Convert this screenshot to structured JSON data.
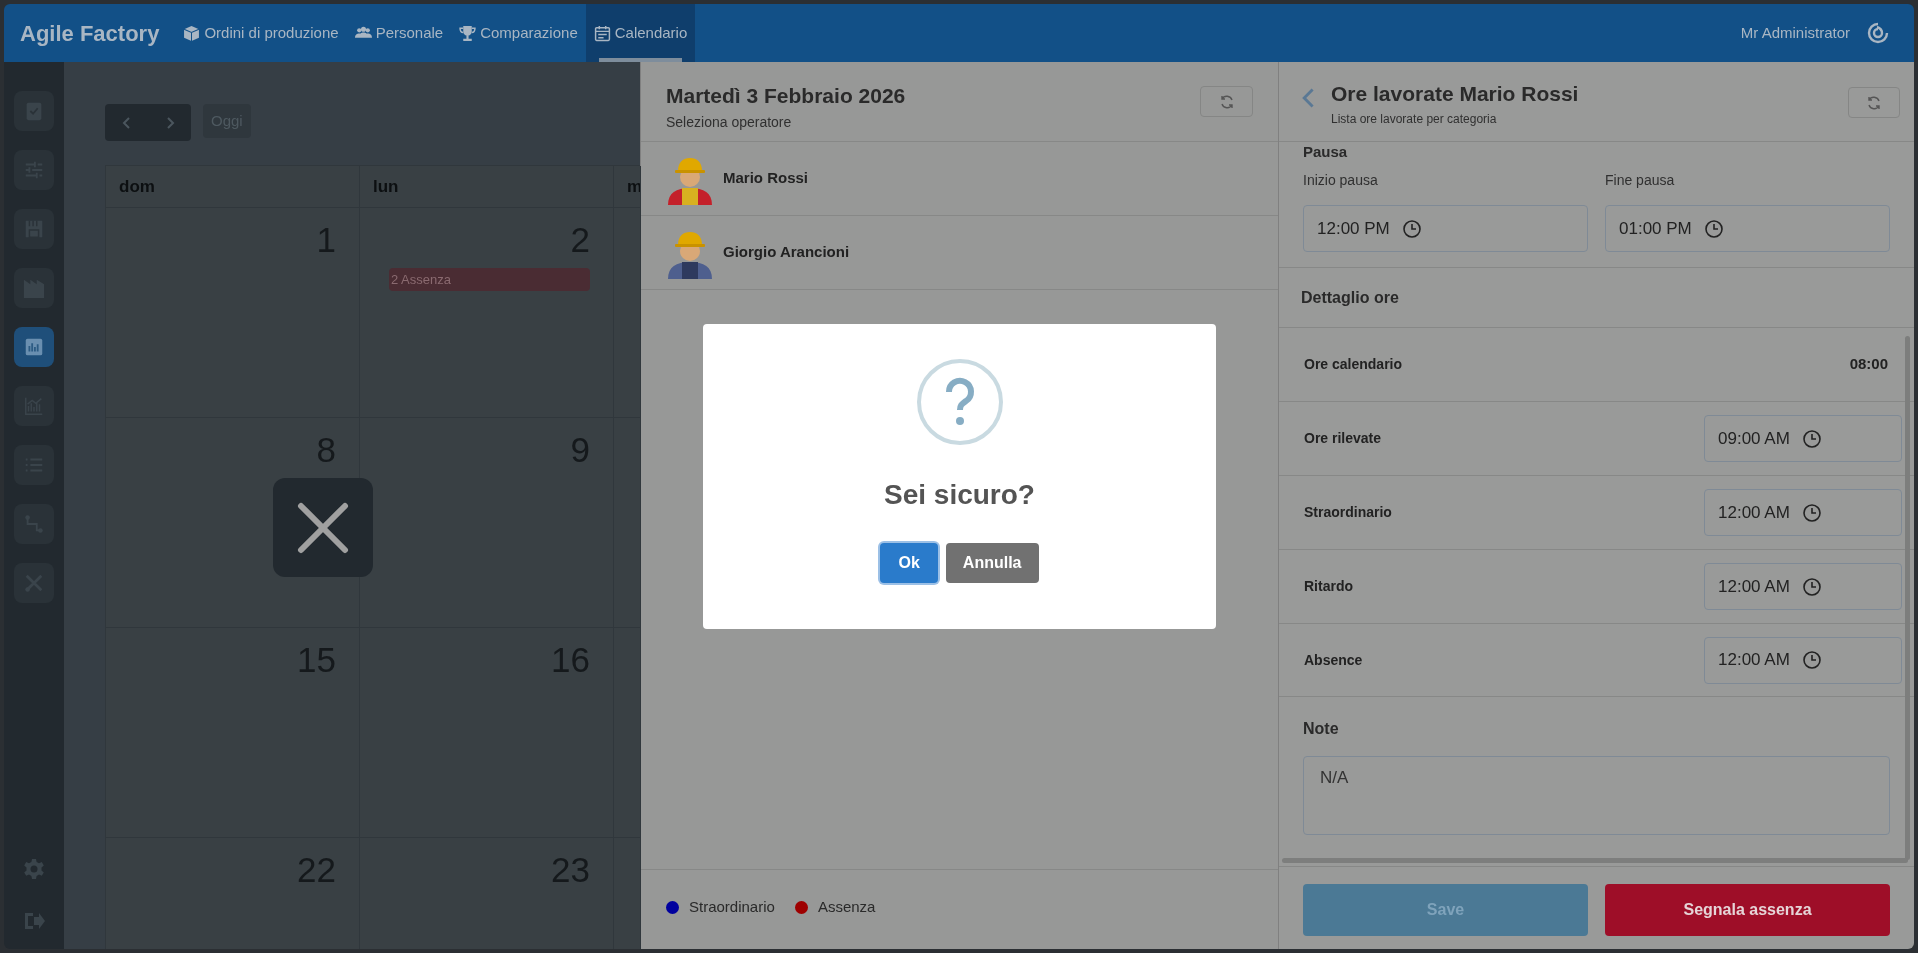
{
  "app": {
    "title": "Agile Factory",
    "user": "Mr Administrator"
  },
  "nav": [
    {
      "label": "Ordini di produzione",
      "selected": false
    },
    {
      "label": "Personale",
      "selected": false
    },
    {
      "label": "Comparazione",
      "selected": false
    },
    {
      "label": "Calendario",
      "selected": true
    }
  ],
  "sidebar": {
    "items": [
      {
        "selected": false
      },
      {
        "selected": false
      },
      {
        "selected": false
      },
      {
        "selected": false
      },
      {
        "selected": true
      },
      {
        "selected": false
      },
      {
        "selected": false
      },
      {
        "selected": false
      },
      {
        "selected": false
      }
    ]
  },
  "calendar": {
    "today_button": "Oggi",
    "columns": [
      "dom",
      "lun",
      "m"
    ],
    "weeks": [
      {
        "days": [
          {
            "number": "1"
          },
          {
            "number": "2",
            "events": [
              {
                "label": "2 Assenza",
                "color": "#4a2c33"
              }
            ]
          }
        ]
      },
      {
        "days": [
          {
            "number": "8"
          },
          {
            "number": "9"
          }
        ]
      },
      {
        "days": [
          {
            "number": "15"
          },
          {
            "number": "16"
          }
        ]
      },
      {
        "days": [
          {
            "number": "22"
          },
          {
            "number": "23"
          }
        ]
      }
    ]
  },
  "day_panel": {
    "title": "Martedì 3 Febbraio 2026",
    "subtitle": "Seleziona operatore",
    "operators": [
      {
        "name": "Mario Rossi",
        "kind": "red"
      },
      {
        "name": "Giorgio Arancioni",
        "kind": "blue"
      }
    ],
    "legend": [
      {
        "label": "Straordinario",
        "color": "#00009e"
      },
      {
        "label": "Assenza",
        "color": "#9e0000"
      }
    ]
  },
  "modal": {
    "title": "Sei sicuro?",
    "buttons": [
      {
        "label": "Ok",
        "kind": "primary"
      },
      {
        "label": "Annulla",
        "kind": "secondary"
      }
    ]
  },
  "hours_panel": {
    "title": "Ore lavorate Mario Rossi",
    "subtitle": "Lista ore lavorate per categoria",
    "pause": {
      "heading": "Pausa",
      "fields": [
        {
          "label": "Inizio pausa",
          "value": "12:00 PM"
        },
        {
          "label": "Fine pausa",
          "value": "01:00 PM"
        }
      ]
    },
    "detail_heading": "Dettaglio ore",
    "rows": [
      {
        "label": "Ore calendario",
        "kind": "text",
        "value": "08:00"
      },
      {
        "label": "Ore rilevate",
        "kind": "time",
        "value": "09:00 AM"
      },
      {
        "label": "Straordinario",
        "kind": "time",
        "value": "12:00 AM"
      },
      {
        "label": "Ritardo",
        "kind": "time",
        "value": "12:00 AM"
      },
      {
        "label": "Absence",
        "kind": "time",
        "value": "12:00 AM"
      }
    ],
    "note": {
      "heading": "Note",
      "value": "N/A"
    },
    "buttons": [
      {
        "label": "Save",
        "kind": "primary",
        "disabled": true
      },
      {
        "label": "Segnala assenza",
        "kind": "danger",
        "disabled": false
      }
    ]
  }
}
